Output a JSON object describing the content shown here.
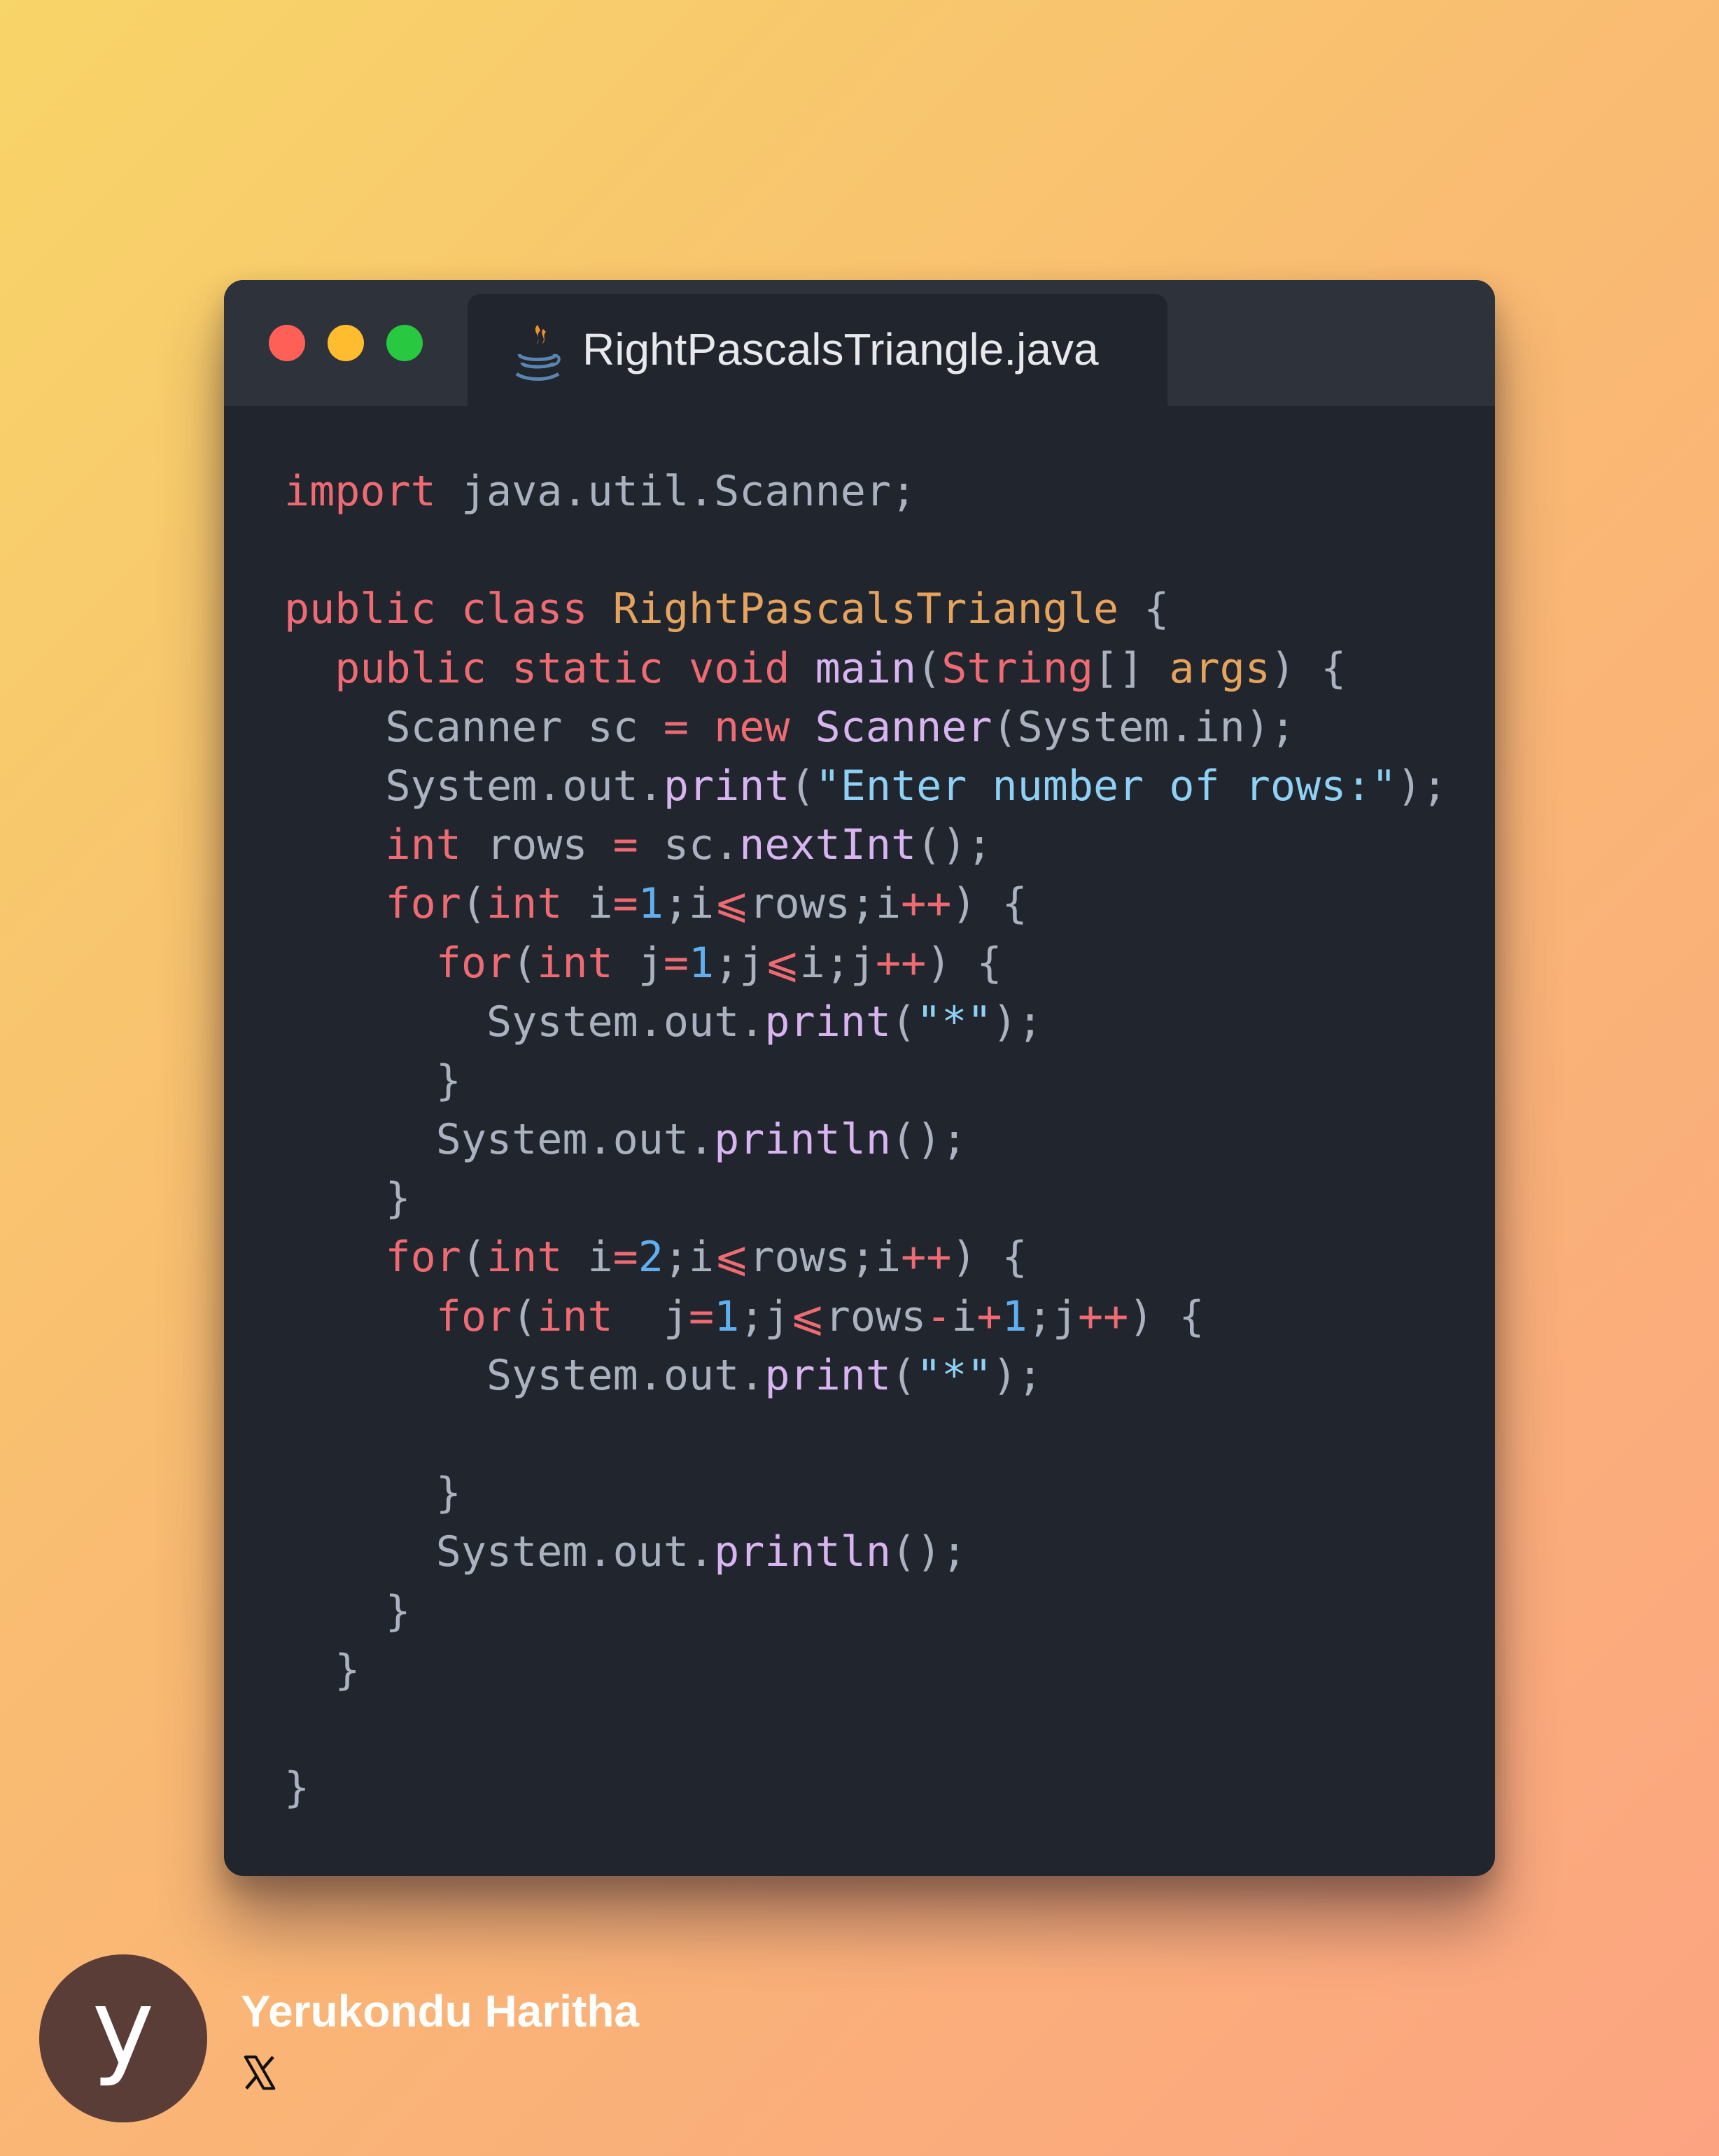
{
  "window": {
    "controls": [
      {
        "name": "close",
        "color": "#fe5f57"
      },
      {
        "name": "minimize",
        "color": "#febc2e"
      },
      {
        "name": "maximize",
        "color": "#28c840"
      }
    ],
    "tab": {
      "icon": "java-coffee-cup-icon",
      "title": "RightPascalsTriangle.java"
    }
  },
  "code": {
    "language": "java",
    "lines": [
      [
        [
          "keyword",
          "import"
        ],
        [
          "plain",
          " java.util.Scanner;"
        ]
      ],
      [],
      [
        [
          "keyword",
          "public"
        ],
        [
          "plain",
          " "
        ],
        [
          "keyword",
          "class"
        ],
        [
          "plain",
          " "
        ],
        [
          "class",
          "RightPascalsTriangle"
        ],
        [
          "plain",
          " {"
        ]
      ],
      [
        [
          "plain",
          "  "
        ],
        [
          "keyword",
          "public"
        ],
        [
          "plain",
          " "
        ],
        [
          "keyword",
          "static"
        ],
        [
          "plain",
          " "
        ],
        [
          "keyword",
          "void"
        ],
        [
          "plain",
          " "
        ],
        [
          "fn",
          "main"
        ],
        [
          "plain",
          "("
        ],
        [
          "type",
          "String"
        ],
        [
          "plain",
          "[] "
        ],
        [
          "param",
          "args"
        ],
        [
          "plain",
          ") {"
        ]
      ],
      [
        [
          "plain",
          "    Scanner sc "
        ],
        [
          "op",
          "="
        ],
        [
          "plain",
          " "
        ],
        [
          "keyword",
          "new"
        ],
        [
          "plain",
          " "
        ],
        [
          "fn",
          "Scanner"
        ],
        [
          "plain",
          "(System.in);"
        ]
      ],
      [
        [
          "plain",
          "    System.out."
        ],
        [
          "fn",
          "print"
        ],
        [
          "plain",
          "("
        ],
        [
          "string",
          "\"Enter number of rows:\""
        ],
        [
          "plain",
          ");"
        ]
      ],
      [
        [
          "plain",
          "    "
        ],
        [
          "keyword",
          "int"
        ],
        [
          "plain",
          " rows "
        ],
        [
          "op",
          "="
        ],
        [
          "plain",
          " sc."
        ],
        [
          "fn",
          "nextInt"
        ],
        [
          "plain",
          "();"
        ]
      ],
      [
        [
          "plain",
          "    "
        ],
        [
          "keyword",
          "for"
        ],
        [
          "plain",
          "("
        ],
        [
          "keyword",
          "int"
        ],
        [
          "plain",
          " i"
        ],
        [
          "op",
          "="
        ],
        [
          "number",
          "1"
        ],
        [
          "plain",
          ";i"
        ],
        [
          "op",
          "⩽"
        ],
        [
          "plain",
          "rows;i"
        ],
        [
          "op",
          "++"
        ],
        [
          "plain",
          ") {"
        ]
      ],
      [
        [
          "plain",
          "      "
        ],
        [
          "keyword",
          "for"
        ],
        [
          "plain",
          "("
        ],
        [
          "keyword",
          "int"
        ],
        [
          "plain",
          " j"
        ],
        [
          "op",
          "="
        ],
        [
          "number",
          "1"
        ],
        [
          "plain",
          ";j"
        ],
        [
          "op",
          "⩽"
        ],
        [
          "plain",
          "i;j"
        ],
        [
          "op",
          "++"
        ],
        [
          "plain",
          ") {"
        ]
      ],
      [
        [
          "plain",
          "        System.out."
        ],
        [
          "fn",
          "print"
        ],
        [
          "plain",
          "("
        ],
        [
          "string",
          "\"*\""
        ],
        [
          "plain",
          ");"
        ]
      ],
      [
        [
          "plain",
          "      }"
        ]
      ],
      [
        [
          "plain",
          "      System.out."
        ],
        [
          "fn",
          "println"
        ],
        [
          "plain",
          "();"
        ]
      ],
      [
        [
          "plain",
          "    }"
        ]
      ],
      [
        [
          "plain",
          "    "
        ],
        [
          "keyword",
          "for"
        ],
        [
          "plain",
          "("
        ],
        [
          "keyword",
          "int"
        ],
        [
          "plain",
          " i"
        ],
        [
          "op",
          "="
        ],
        [
          "number",
          "2"
        ],
        [
          "plain",
          ";i"
        ],
        [
          "op",
          "⩽"
        ],
        [
          "plain",
          "rows;i"
        ],
        [
          "op",
          "++"
        ],
        [
          "plain",
          ") {"
        ]
      ],
      [
        [
          "plain",
          "      "
        ],
        [
          "keyword",
          "for"
        ],
        [
          "plain",
          "("
        ],
        [
          "keyword",
          "int"
        ],
        [
          "plain",
          "  j"
        ],
        [
          "op",
          "="
        ],
        [
          "number",
          "1"
        ],
        [
          "plain",
          ";j"
        ],
        [
          "op",
          "⩽"
        ],
        [
          "plain",
          "rows"
        ],
        [
          "op",
          "-"
        ],
        [
          "plain",
          "i"
        ],
        [
          "op",
          "+"
        ],
        [
          "number",
          "1"
        ],
        [
          "plain",
          ";j"
        ],
        [
          "op",
          "++"
        ],
        [
          "plain",
          ") {"
        ]
      ],
      [
        [
          "plain",
          "        System.out."
        ],
        [
          "fn",
          "print"
        ],
        [
          "plain",
          "("
        ],
        [
          "string",
          "\"*\""
        ],
        [
          "plain",
          ");"
        ]
      ],
      [],
      [
        [
          "plain",
          "      }"
        ]
      ],
      [
        [
          "plain",
          "      System.out."
        ],
        [
          "fn",
          "println"
        ],
        [
          "plain",
          "();"
        ]
      ],
      [
        [
          "plain",
          "    }"
        ]
      ],
      [
        [
          "plain",
          "  }"
        ]
      ],
      [],
      [
        [
          "plain",
          "}"
        ]
      ]
    ]
  },
  "author": {
    "initial": "y",
    "name": "Yerukondu Haritha",
    "social_icon": "x-logo-icon"
  }
}
